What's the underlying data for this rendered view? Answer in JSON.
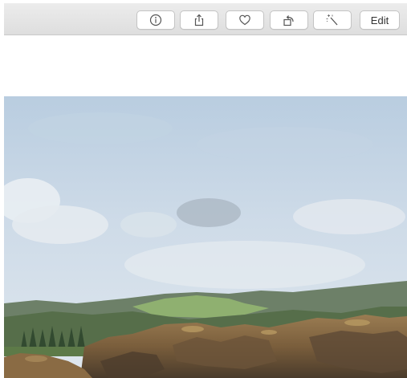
{
  "toolbar": {
    "buttons": [
      {
        "name": "info",
        "icon": "info-icon"
      },
      {
        "name": "share",
        "icon": "share-icon"
      },
      {
        "name": "favorite",
        "icon": "heart-icon"
      },
      {
        "name": "rotate",
        "icon": "rotate-icon"
      },
      {
        "name": "enhance",
        "icon": "magic-wand-icon"
      }
    ],
    "edit_label": "Edit"
  },
  "photo": {
    "subject": "coastal-landscape-photo"
  },
  "colors": {
    "toolbar_bg": "#e4e4e4",
    "button_bg": "#ffffff",
    "button_border": "#c4c4c4",
    "icon_color": "#555555",
    "sky": "#c9d9e8",
    "hills": "#5f7a55",
    "rocks": "#8a6b44"
  }
}
